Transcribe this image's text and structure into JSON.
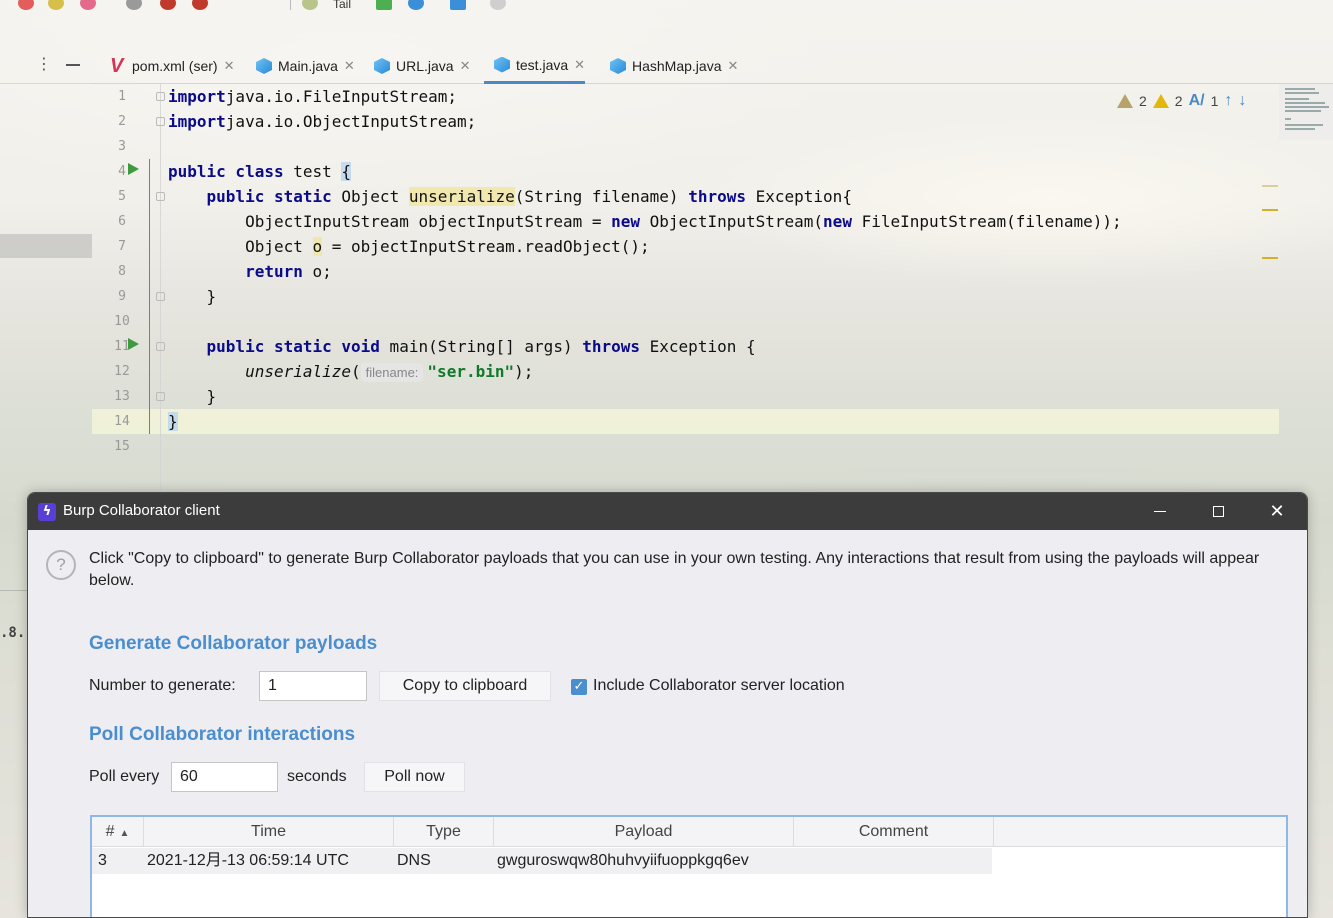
{
  "toolbar": {
    "run_config": "Tail"
  },
  "left_panel": {
    "version_fragment": ".8."
  },
  "tabs": [
    {
      "label": "pom.xml (ser)",
      "icon": "maven-icon",
      "active": false
    },
    {
      "label": "Main.java",
      "icon": "java-class-icon",
      "active": false
    },
    {
      "label": "URL.java",
      "icon": "java-class-icon",
      "active": false
    },
    {
      "label": "test.java",
      "icon": "java-class-icon",
      "active": true
    },
    {
      "label": "HashMap.java",
      "icon": "java-class-icon",
      "active": false
    }
  ],
  "editor": {
    "line_numbers": [
      "1",
      "2",
      "3",
      "4",
      "5",
      "6",
      "7",
      "8",
      "9",
      "10",
      "11",
      "12",
      "13",
      "14",
      "15"
    ],
    "inspection": {
      "weak_warnings": "2",
      "warnings": "2",
      "typos": "1"
    },
    "param_hint": "filename:",
    "lines": [
      [
        [
          "kw",
          "import"
        ],
        [
          "",
          "java.io.FileInputStream;"
        ]
      ],
      [
        [
          "kw",
          "import"
        ],
        [
          "",
          "java.io.ObjectInputStream;"
        ]
      ],
      [],
      [
        [
          "kw",
          "public class"
        ],
        [
          "",
          " test "
        ],
        [
          "brace",
          "{"
        ]
      ],
      [
        [
          "",
          "    "
        ],
        [
          "kw",
          "public static"
        ],
        [
          "",
          " Object "
        ],
        [
          "hl",
          "unserialize"
        ],
        [
          "",
          "(String filename) "
        ],
        [
          "kw",
          "throws"
        ],
        [
          "",
          " Exception{"
        ]
      ],
      [
        [
          "",
          "        ObjectInputStream objectInputStream = "
        ],
        [
          "kw",
          "new"
        ],
        [
          "",
          " ObjectInputStream("
        ],
        [
          "kw",
          "new"
        ],
        [
          "",
          " FileInputStream(filename));"
        ]
      ],
      [
        [
          "",
          "        Object "
        ],
        [
          "hl",
          "o"
        ],
        [
          "",
          " = objectInputStream.readObject();"
        ]
      ],
      [
        [
          "",
          "        "
        ],
        [
          "kw",
          "return"
        ],
        [
          "",
          " o;"
        ]
      ],
      [
        [
          "",
          "    }"
        ]
      ],
      [],
      [
        [
          "",
          "    "
        ],
        [
          "kw",
          "public static void"
        ],
        [
          "",
          " main(String[] args) "
        ],
        [
          "kw",
          "throws"
        ],
        [
          "",
          " Exception {"
        ]
      ],
      [
        [
          "",
          "        "
        ],
        [
          "it",
          "unserialize"
        ],
        [
          "",
          "("
        ],
        [
          "hint",
          "filename:"
        ],
        [
          "str",
          "\"ser.bin\""
        ],
        [
          "",
          ");"
        ]
      ],
      [
        [
          "",
          "    }"
        ]
      ],
      [
        [
          "brace",
          "}"
        ]
      ],
      []
    ]
  },
  "dialog": {
    "title": "Burp Collaborator client",
    "help_text": "Click \"Copy to clipboard\" to generate Burp Collaborator payloads that you can use in your own testing. Any interactions that result from using the payloads will appear below.",
    "generate": {
      "heading": "Generate Collaborator payloads",
      "number_label": "Number to generate:",
      "number_value": "1",
      "copy_button": "Copy to clipboard",
      "include_location_label": "Include Collaborator server location",
      "include_location_checked": true
    },
    "poll": {
      "heading": "Poll Collaborator interactions",
      "poll_every_label": "Poll every",
      "interval_value": "60",
      "seconds_label": "seconds",
      "poll_now_button": "Poll now"
    },
    "table": {
      "columns": [
        "#",
        "Time",
        "Type",
        "Payload",
        "Comment"
      ],
      "rows": [
        {
          "num": "3",
          "time": "2021-12月-13 06:59:14 UTC",
          "type": "DNS",
          "payload": "gwguroswqw80huhvyiifuoppkgq6ev",
          "comment": ""
        }
      ]
    }
  }
}
